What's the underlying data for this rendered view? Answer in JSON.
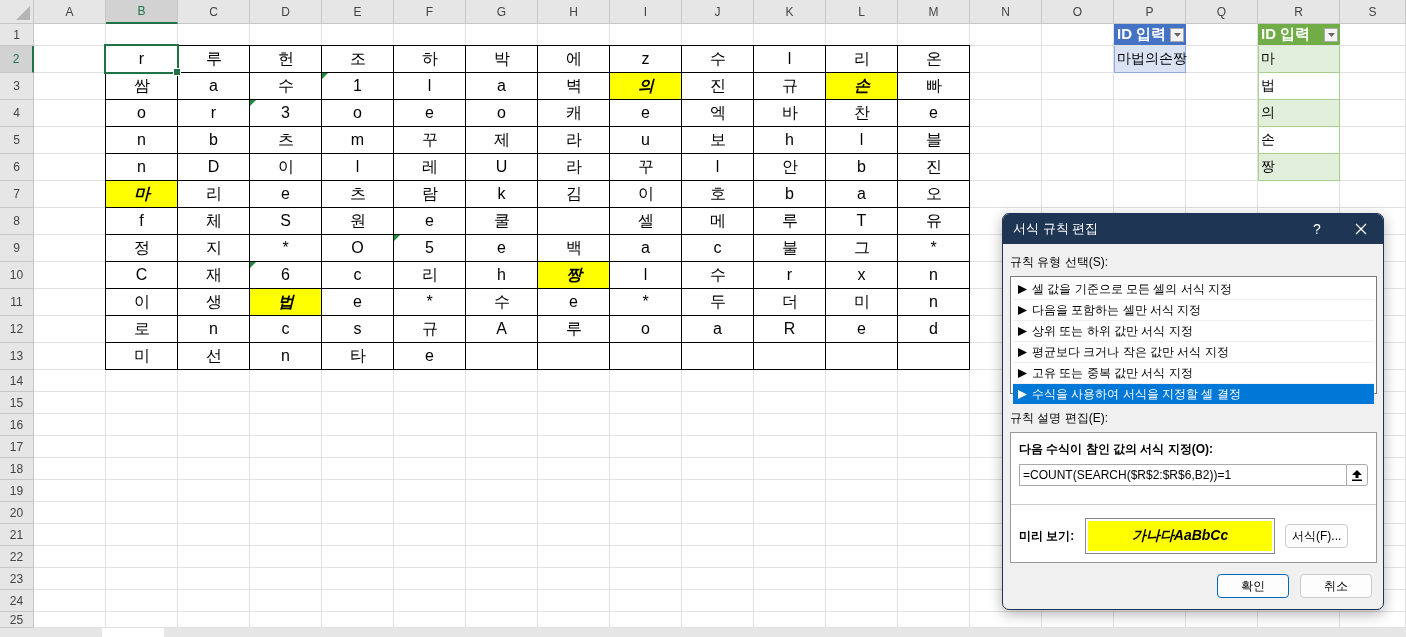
{
  "columns": [
    {
      "label": "A",
      "selected": false
    },
    {
      "label": "B",
      "selected": true
    },
    {
      "label": "C",
      "selected": false
    },
    {
      "label": "D",
      "selected": false
    },
    {
      "label": "E",
      "selected": false
    },
    {
      "label": "F",
      "selected": false
    },
    {
      "label": "G",
      "selected": false
    },
    {
      "label": "H",
      "selected": false
    },
    {
      "label": "I",
      "selected": false
    },
    {
      "label": "J",
      "selected": false
    },
    {
      "label": "K",
      "selected": false
    },
    {
      "label": "L",
      "selected": false
    },
    {
      "label": "M",
      "selected": false
    },
    {
      "label": "N",
      "selected": false
    },
    {
      "label": "O",
      "selected": false
    },
    {
      "label": "P",
      "selected": false
    },
    {
      "label": "Q",
      "selected": false
    },
    {
      "label": "R",
      "selected": false
    },
    {
      "label": "S",
      "selected": false
    }
  ],
  "rows": [
    {
      "label": "1",
      "selected": false
    },
    {
      "label": "2",
      "selected": true
    },
    {
      "label": "3",
      "selected": false
    },
    {
      "label": "4",
      "selected": false
    },
    {
      "label": "5",
      "selected": false
    },
    {
      "label": "6",
      "selected": false
    },
    {
      "label": "7",
      "selected": false
    },
    {
      "label": "8",
      "selected": false
    },
    {
      "label": "9",
      "selected": false
    },
    {
      "label": "10",
      "selected": false
    },
    {
      "label": "11",
      "selected": false
    },
    {
      "label": "12",
      "selected": false
    },
    {
      "label": "13",
      "selected": false
    },
    {
      "label": "14",
      "selected": false
    },
    {
      "label": "15",
      "selected": false
    },
    {
      "label": "16",
      "selected": false
    },
    {
      "label": "17",
      "selected": false
    },
    {
      "label": "18",
      "selected": false
    },
    {
      "label": "19",
      "selected": false
    },
    {
      "label": "20",
      "selected": false
    },
    {
      "label": "21",
      "selected": false
    },
    {
      "label": "22",
      "selected": false
    },
    {
      "label": "23",
      "selected": false
    },
    {
      "label": "24",
      "selected": false
    },
    {
      "label": "25",
      "selected": false
    }
  ],
  "grid": [
    [
      {
        "text": "r",
        "highlighted": false,
        "flagged": false,
        "selected": true
      },
      {
        "text": "루",
        "highlighted": false,
        "flagged": false,
        "selected": false
      },
      {
        "text": "헌",
        "highlighted": false,
        "flagged": false,
        "selected": false
      },
      {
        "text": "조",
        "highlighted": false,
        "flagged": false,
        "selected": false
      },
      {
        "text": "하",
        "highlighted": false,
        "flagged": false,
        "selected": false
      },
      {
        "text": "박",
        "highlighted": false,
        "flagged": false,
        "selected": false
      },
      {
        "text": "에",
        "highlighted": false,
        "flagged": false,
        "selected": false
      },
      {
        "text": "z",
        "highlighted": false,
        "flagged": false,
        "selected": false
      },
      {
        "text": "수",
        "highlighted": false,
        "flagged": false,
        "selected": false
      },
      {
        "text": "l",
        "highlighted": false,
        "flagged": false,
        "selected": false
      },
      {
        "text": "리",
        "highlighted": false,
        "flagged": false,
        "selected": false
      },
      {
        "text": "온",
        "highlighted": false,
        "flagged": false,
        "selected": false
      }
    ],
    [
      {
        "text": "쌈",
        "highlighted": false,
        "flagged": false,
        "selected": false
      },
      {
        "text": "a",
        "highlighted": false,
        "flagged": false,
        "selected": false
      },
      {
        "text": "수",
        "highlighted": false,
        "flagged": false,
        "selected": false
      },
      {
        "text": "1",
        "highlighted": false,
        "flagged": true,
        "selected": false
      },
      {
        "text": "l",
        "highlighted": false,
        "flagged": false,
        "selected": false
      },
      {
        "text": "a",
        "highlighted": false,
        "flagged": false,
        "selected": false
      },
      {
        "text": "벽",
        "highlighted": false,
        "flagged": false,
        "selected": false
      },
      {
        "text": "의",
        "highlighted": true,
        "flagged": false,
        "selected": false
      },
      {
        "text": "진",
        "highlighted": false,
        "flagged": false,
        "selected": false
      },
      {
        "text": "규",
        "highlighted": false,
        "flagged": false,
        "selected": false
      },
      {
        "text": "손",
        "highlighted": true,
        "flagged": false,
        "selected": false
      },
      {
        "text": "빠",
        "highlighted": false,
        "flagged": false,
        "selected": false
      }
    ],
    [
      {
        "text": "o",
        "highlighted": false,
        "flagged": false,
        "selected": false
      },
      {
        "text": "r",
        "highlighted": false,
        "flagged": false,
        "selected": false
      },
      {
        "text": "3",
        "highlighted": false,
        "flagged": true,
        "selected": false
      },
      {
        "text": "o",
        "highlighted": false,
        "flagged": false,
        "selected": false
      },
      {
        "text": "e",
        "highlighted": false,
        "flagged": false,
        "selected": false
      },
      {
        "text": "o",
        "highlighted": false,
        "flagged": false,
        "selected": false
      },
      {
        "text": "캐",
        "highlighted": false,
        "flagged": false,
        "selected": false
      },
      {
        "text": "e",
        "highlighted": false,
        "flagged": false,
        "selected": false
      },
      {
        "text": "엑",
        "highlighted": false,
        "flagged": false,
        "selected": false
      },
      {
        "text": "바",
        "highlighted": false,
        "flagged": false,
        "selected": false
      },
      {
        "text": "찬",
        "highlighted": false,
        "flagged": false,
        "selected": false
      },
      {
        "text": "e",
        "highlighted": false,
        "flagged": false,
        "selected": false
      }
    ],
    [
      {
        "text": "n",
        "highlighted": false,
        "flagged": false,
        "selected": false
      },
      {
        "text": "b",
        "highlighted": false,
        "flagged": false,
        "selected": false
      },
      {
        "text": "츠",
        "highlighted": false,
        "flagged": false,
        "selected": false
      },
      {
        "text": "m",
        "highlighted": false,
        "flagged": false,
        "selected": false
      },
      {
        "text": "꾸",
        "highlighted": false,
        "flagged": false,
        "selected": false
      },
      {
        "text": "제",
        "highlighted": false,
        "flagged": false,
        "selected": false
      },
      {
        "text": "라",
        "highlighted": false,
        "flagged": false,
        "selected": false
      },
      {
        "text": "u",
        "highlighted": false,
        "flagged": false,
        "selected": false
      },
      {
        "text": "보",
        "highlighted": false,
        "flagged": false,
        "selected": false
      },
      {
        "text": "h",
        "highlighted": false,
        "flagged": false,
        "selected": false
      },
      {
        "text": "l",
        "highlighted": false,
        "flagged": false,
        "selected": false
      },
      {
        "text": "블",
        "highlighted": false,
        "flagged": false,
        "selected": false
      }
    ],
    [
      {
        "text": "n",
        "highlighted": false,
        "flagged": false,
        "selected": false
      },
      {
        "text": "D",
        "highlighted": false,
        "flagged": false,
        "selected": false
      },
      {
        "text": "이",
        "highlighted": false,
        "flagged": false,
        "selected": false
      },
      {
        "text": "l",
        "highlighted": false,
        "flagged": false,
        "selected": false
      },
      {
        "text": "레",
        "highlighted": false,
        "flagged": false,
        "selected": false
      },
      {
        "text": "U",
        "highlighted": false,
        "flagged": false,
        "selected": false
      },
      {
        "text": "라",
        "highlighted": false,
        "flagged": false,
        "selected": false
      },
      {
        "text": "꾸",
        "highlighted": false,
        "flagged": false,
        "selected": false
      },
      {
        "text": "l",
        "highlighted": false,
        "flagged": false,
        "selected": false
      },
      {
        "text": "안",
        "highlighted": false,
        "flagged": false,
        "selected": false
      },
      {
        "text": "b",
        "highlighted": false,
        "flagged": false,
        "selected": false
      },
      {
        "text": "진",
        "highlighted": false,
        "flagged": false,
        "selected": false
      }
    ],
    [
      {
        "text": "마",
        "highlighted": true,
        "flagged": false,
        "selected": false
      },
      {
        "text": "리",
        "highlighted": false,
        "flagged": false,
        "selected": false
      },
      {
        "text": "e",
        "highlighted": false,
        "flagged": false,
        "selected": false
      },
      {
        "text": "츠",
        "highlighted": false,
        "flagged": false,
        "selected": false
      },
      {
        "text": "람",
        "highlighted": false,
        "flagged": false,
        "selected": false
      },
      {
        "text": "k",
        "highlighted": false,
        "flagged": false,
        "selected": false
      },
      {
        "text": "김",
        "highlighted": false,
        "flagged": false,
        "selected": false
      },
      {
        "text": "이",
        "highlighted": false,
        "flagged": false,
        "selected": false
      },
      {
        "text": "호",
        "highlighted": false,
        "flagged": false,
        "selected": false
      },
      {
        "text": "b",
        "highlighted": false,
        "flagged": false,
        "selected": false
      },
      {
        "text": "a",
        "highlighted": false,
        "flagged": false,
        "selected": false
      },
      {
        "text": "오",
        "highlighted": false,
        "flagged": false,
        "selected": false
      }
    ],
    [
      {
        "text": "f",
        "highlighted": false,
        "flagged": false,
        "selected": false
      },
      {
        "text": "체",
        "highlighted": false,
        "flagged": false,
        "selected": false
      },
      {
        "text": "S",
        "highlighted": false,
        "flagged": false,
        "selected": false
      },
      {
        "text": "원",
        "highlighted": false,
        "flagged": false,
        "selected": false
      },
      {
        "text": "e",
        "highlighted": false,
        "flagged": false,
        "selected": false
      },
      {
        "text": "쿨",
        "highlighted": false,
        "flagged": false,
        "selected": false
      },
      {
        "highlighted": false,
        "flagged": false,
        "selected": false
      },
      {
        "text": "셀",
        "highlighted": false,
        "flagged": false,
        "selected": false
      },
      {
        "text": "메",
        "highlighted": false,
        "flagged": false,
        "selected": false
      },
      {
        "text": "루",
        "highlighted": false,
        "flagged": false,
        "selected": false
      },
      {
        "text": "T",
        "highlighted": false,
        "flagged": false,
        "selected": false
      },
      {
        "text": "유",
        "highlighted": false,
        "flagged": false,
        "selected": false
      }
    ],
    [
      {
        "text": "정",
        "highlighted": false,
        "flagged": false,
        "selected": false
      },
      {
        "text": "지",
        "highlighted": false,
        "flagged": false,
        "selected": false
      },
      {
        "text": "*",
        "highlighted": false,
        "flagged": false,
        "selected": false
      },
      {
        "text": "O",
        "highlighted": false,
        "flagged": false,
        "selected": false
      },
      {
        "text": "5",
        "highlighted": false,
        "flagged": true,
        "selected": false
      },
      {
        "text": "e",
        "highlighted": false,
        "flagged": false,
        "selected": false
      },
      {
        "text": "백",
        "highlighted": false,
        "flagged": false,
        "selected": false
      },
      {
        "text": "a",
        "highlighted": false,
        "flagged": false,
        "selected": false
      },
      {
        "text": "c",
        "highlighted": false,
        "flagged": false,
        "selected": false
      },
      {
        "text": "불",
        "highlighted": false,
        "flagged": false,
        "selected": false
      },
      {
        "text": "그",
        "highlighted": false,
        "flagged": false,
        "selected": false
      },
      {
        "text": "*",
        "highlighted": false,
        "flagged": false,
        "selected": false
      }
    ],
    [
      {
        "text": "C",
        "highlighted": false,
        "flagged": false,
        "selected": false
      },
      {
        "text": "재",
        "highlighted": false,
        "flagged": false,
        "selected": false
      },
      {
        "text": "6",
        "highlighted": false,
        "flagged": true,
        "selected": false
      },
      {
        "text": "c",
        "highlighted": false,
        "flagged": false,
        "selected": false
      },
      {
        "text": "리",
        "highlighted": false,
        "flagged": false,
        "selected": false
      },
      {
        "text": "h",
        "highlighted": false,
        "flagged": false,
        "selected": false
      },
      {
        "text": "짱",
        "highlighted": true,
        "flagged": false,
        "selected": false
      },
      {
        "text": "l",
        "highlighted": false,
        "flagged": false,
        "selected": false
      },
      {
        "text": "수",
        "highlighted": false,
        "flagged": false,
        "selected": false
      },
      {
        "text": "r",
        "highlighted": false,
        "flagged": false,
        "selected": false
      },
      {
        "text": "x",
        "highlighted": false,
        "flagged": false,
        "selected": false
      },
      {
        "text": "n",
        "highlighted": false,
        "flagged": false,
        "selected": false
      }
    ],
    [
      {
        "text": "이",
        "highlighted": false,
        "flagged": false,
        "selected": false
      },
      {
        "text": "생",
        "highlighted": false,
        "flagged": false,
        "selected": false
      },
      {
        "text": "법",
        "highlighted": true,
        "flagged": false,
        "selected": false
      },
      {
        "text": "e",
        "highlighted": false,
        "flagged": false,
        "selected": false
      },
      {
        "text": "*",
        "highlighted": false,
        "flagged": false,
        "selected": false
      },
      {
        "text": "수",
        "highlighted": false,
        "flagged": false,
        "selected": false
      },
      {
        "text": "e",
        "highlighted": false,
        "flagged": false,
        "selected": false
      },
      {
        "text": "*",
        "highlighted": false,
        "flagged": false,
        "selected": false
      },
      {
        "text": "두",
        "highlighted": false,
        "flagged": false,
        "selected": false
      },
      {
        "text": "더",
        "highlighted": false,
        "flagged": false,
        "selected": false
      },
      {
        "text": "미",
        "highlighted": false,
        "flagged": false,
        "selected": false
      },
      {
        "text": "n",
        "highlighted": false,
        "flagged": false,
        "selected": false
      }
    ],
    [
      {
        "text": "로",
        "highlighted": false,
        "flagged": false,
        "selected": false
      },
      {
        "text": "n",
        "highlighted": false,
        "flagged": false,
        "selected": false
      },
      {
        "text": "c",
        "highlighted": false,
        "flagged": false,
        "selected": false
      },
      {
        "text": "s",
        "highlighted": false,
        "flagged": false,
        "selected": false
      },
      {
        "text": "규",
        "highlighted": false,
        "flagged": false,
        "selected": false
      },
      {
        "text": "A",
        "highlighted": false,
        "flagged": false,
        "selected": false
      },
      {
        "text": "루",
        "highlighted": false,
        "flagged": false,
        "selected": false
      },
      {
        "text": "o",
        "highlighted": false,
        "flagged": false,
        "selected": false
      },
      {
        "text": "a",
        "highlighted": false,
        "flagged": false,
        "selected": false
      },
      {
        "text": "R",
        "highlighted": false,
        "flagged": false,
        "selected": false
      },
      {
        "text": "e",
        "highlighted": false,
        "flagged": false,
        "selected": false
      },
      {
        "text": "d",
        "highlighted": false,
        "flagged": false,
        "selected": false
      }
    ],
    [
      {
        "text": "미",
        "highlighted": false,
        "flagged": false,
        "selected": false
      },
      {
        "text": "선",
        "highlighted": false,
        "flagged": false,
        "selected": false
      },
      {
        "text": "n",
        "highlighted": false,
        "flagged": false,
        "selected": false
      },
      {
        "text": "타",
        "highlighted": false,
        "flagged": false,
        "selected": false
      },
      {
        "text": "e",
        "highlighted": false,
        "flagged": false,
        "selected": false
      },
      {
        "highlighted": false,
        "flagged": false,
        "selected": false
      },
      {
        "highlighted": false,
        "flagged": false,
        "selected": false
      },
      {
        "highlighted": false,
        "flagged": false,
        "selected": false
      },
      {
        "highlighted": false,
        "flagged": false,
        "selected": false
      },
      {
        "highlighted": false,
        "flagged": false,
        "selected": false
      },
      {
        "highlighted": false,
        "flagged": false,
        "selected": false
      },
      {
        "highlighted": false,
        "flagged": false,
        "selected": false
      }
    ]
  ],
  "tables": [
    {
      "header": "ID 입력",
      "color": "#4472c4",
      "cells": [
        "마법의손짱"
      ]
    },
    {
      "header": "ID 입력",
      "color": "#70ad47",
      "cells": [
        "마",
        "법",
        "의",
        "손",
        "짱"
      ]
    }
  ],
  "dialog": {
    "title": "서식 규칙 편집",
    "help": "?",
    "rule_type_label": "규칙 유형 선택(S):",
    "rule_types": [
      {
        "label": "셀 값을 기준으로 모든 셀의 서식 지정",
        "selected": false
      },
      {
        "label": "다음을 포함하는 셀만 서식 지정",
        "selected": false
      },
      {
        "label": "상위 또는 하위 값만 서식 지정",
        "selected": false
      },
      {
        "label": "평균보다 크거나 작은 값만 서식 지정",
        "selected": false
      },
      {
        "label": "고유 또는 중복 값만 서식 지정",
        "selected": false
      },
      {
        "label": "수식을 사용하여 서식을 지정할 셀 결정",
        "selected": true
      }
    ],
    "description_label": "규칙 설명 편집(E):",
    "formula_label": "다음 수식이 참인 값의 서식 지정(O):",
    "formula": "=COUNT(SEARCH($R$2:$R$6,B2))=1",
    "preview_label": "미리 보기:",
    "preview_text": "가나다AaBbCc",
    "format_button": "서식(F)...",
    "buttons": [
      {
        "label": "확인",
        "default": true
      },
      {
        "label": "취소",
        "default": false
      }
    ]
  }
}
